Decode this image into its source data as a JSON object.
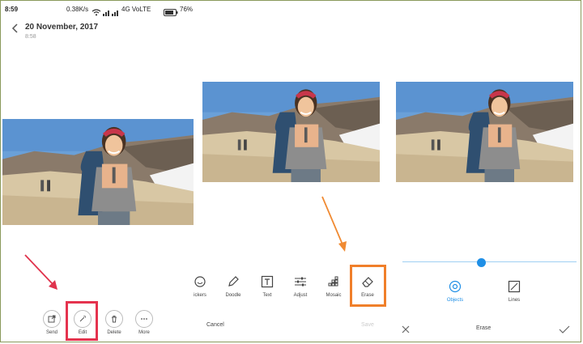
{
  "status_bar": {
    "time": "8:59",
    "network_speed": "0.38K/s",
    "network_label": "4G VoLTE",
    "battery": "76%"
  },
  "header": {
    "date": "20 November, 2017",
    "time": "8:58"
  },
  "panel1": {
    "actions": [
      {
        "label": "Send",
        "icon": "share-icon"
      },
      {
        "label": "Edit",
        "icon": "magic-wand-icon"
      },
      {
        "label": "Delete",
        "icon": "trash-icon"
      },
      {
        "label": "More",
        "icon": "more-dots-icon"
      }
    ]
  },
  "panel2": {
    "tools": [
      {
        "label": "ickers",
        "icon": "stickers-icon"
      },
      {
        "label": "Doodle",
        "icon": "pencil-icon"
      },
      {
        "label": "Text",
        "icon": "text-icon"
      },
      {
        "label": "Adjust",
        "icon": "sliders-icon"
      },
      {
        "label": "Mosaic",
        "icon": "mosaic-icon"
      },
      {
        "label": "Erase",
        "icon": "eraser-icon"
      }
    ],
    "cancel_label": "Cancel",
    "save_label": "Save"
  },
  "panel3": {
    "slider_value": 0.45,
    "modes": [
      {
        "label": "Objects",
        "icon": "target-icon",
        "active": true
      },
      {
        "label": "Lines",
        "icon": "line-icon",
        "active": false
      }
    ],
    "title": "Erase"
  },
  "colors": {
    "accent_blue": "#1f8fe6",
    "highlight_red": "#e5334e",
    "highlight_orange": "#f07f2a",
    "arrow_red": "#e0334d",
    "arrow_orange": "#f08a32"
  }
}
